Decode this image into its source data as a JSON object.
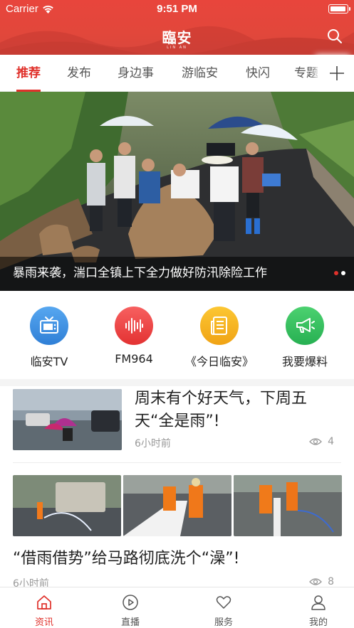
{
  "status_bar": {
    "carrier": "Carrier",
    "time": "9:51 PM"
  },
  "header": {
    "logo_text": "臨安",
    "logo_sub": "LIN  AN",
    "accent_color": "#e2473b"
  },
  "tabs": [
    {
      "label": "推荐",
      "active": true
    },
    {
      "label": "发布"
    },
    {
      "label": "身边事"
    },
    {
      "label": "游临安"
    },
    {
      "label": "快闪"
    },
    {
      "label": "专题"
    }
  ],
  "banner": {
    "caption": "暴雨来袭，湍口全镇上下全力做好防汛除险工作",
    "slide_count": 2,
    "active_slide": 1
  },
  "quick_links": [
    {
      "label": "临安TV",
      "icon": "tv-icon",
      "color": "#3d8fe0"
    },
    {
      "label": "FM964",
      "icon": "audio-wave-icon",
      "color": "#ee4444"
    },
    {
      "label": "《今日临安》",
      "icon": "newspaper-icon",
      "color": "#f5b01e"
    },
    {
      "label": "我要爆料",
      "icon": "megaphone-icon",
      "color": "#35c25f"
    }
  ],
  "articles": [
    {
      "title": "周末有个好天气，下周五天“全是雨”!",
      "time": "6小时前",
      "views": "4"
    },
    {
      "title": "“借雨借势”给马路彻底洗个“澡”!",
      "time": "6小时前",
      "views": "8"
    }
  ],
  "bottom_nav": [
    {
      "label": "资讯",
      "icon": "home-icon",
      "active": true
    },
    {
      "label": "直播",
      "icon": "play-circle-icon"
    },
    {
      "label": "服务",
      "icon": "heart-icon"
    },
    {
      "label": "我的",
      "icon": "user-icon"
    }
  ]
}
